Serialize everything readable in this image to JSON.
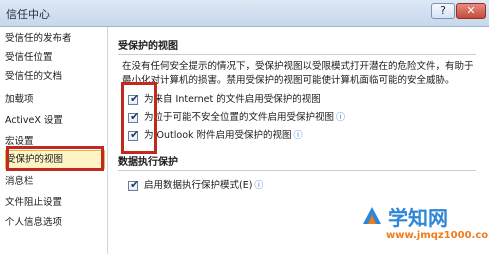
{
  "window": {
    "title": "信任中心",
    "help_label": "?",
    "close_label": "✕"
  },
  "sidebar": {
    "items": [
      {
        "label": "受信任的发布者"
      },
      {
        "label": "受信任位置"
      },
      {
        "label": "受信任的文档"
      },
      {
        "label": "加载项"
      },
      {
        "label": "ActiveX 设置"
      },
      {
        "label": "宏设置"
      },
      {
        "label": "受保护的视图",
        "selected": true
      },
      {
        "label": "消息栏"
      },
      {
        "label": "文件阻止设置"
      },
      {
        "label": "个人信息选项"
      }
    ]
  },
  "protected_view": {
    "header": "受保护的视图",
    "description": "在没有任何安全提示的情况下，受保护视图以受限模式打开潜在的危险文件，有助于最小化对计算机的损害。禁用受保护的视图可能使计算机面临可能的安全威胁。",
    "options": [
      {
        "label": "为来自 Internet 的文件启用受保护的视图",
        "checked": true,
        "info": false
      },
      {
        "label": "为位于可能不安全位置的文件启用受保护视图",
        "checked": true,
        "info": true
      },
      {
        "label": "为 Outlook 附件启用受保护的视图",
        "checked": true,
        "info": true
      }
    ]
  },
  "dep": {
    "header": "数据执行保护",
    "option": {
      "label": "启用数据执行保护模式(E)",
      "checked": true,
      "info": true
    }
  },
  "icons": {
    "info": "info-icon",
    "checkmark": "✔"
  },
  "watermark": {
    "title": "学知网",
    "url": "www.jmqz1000.com"
  },
  "colors": {
    "highlight_outline": "#c1291e",
    "selected_bg": "#fff4c6",
    "watermark_blue": "#2d86d8",
    "watermark_orange": "#f07c1b"
  }
}
